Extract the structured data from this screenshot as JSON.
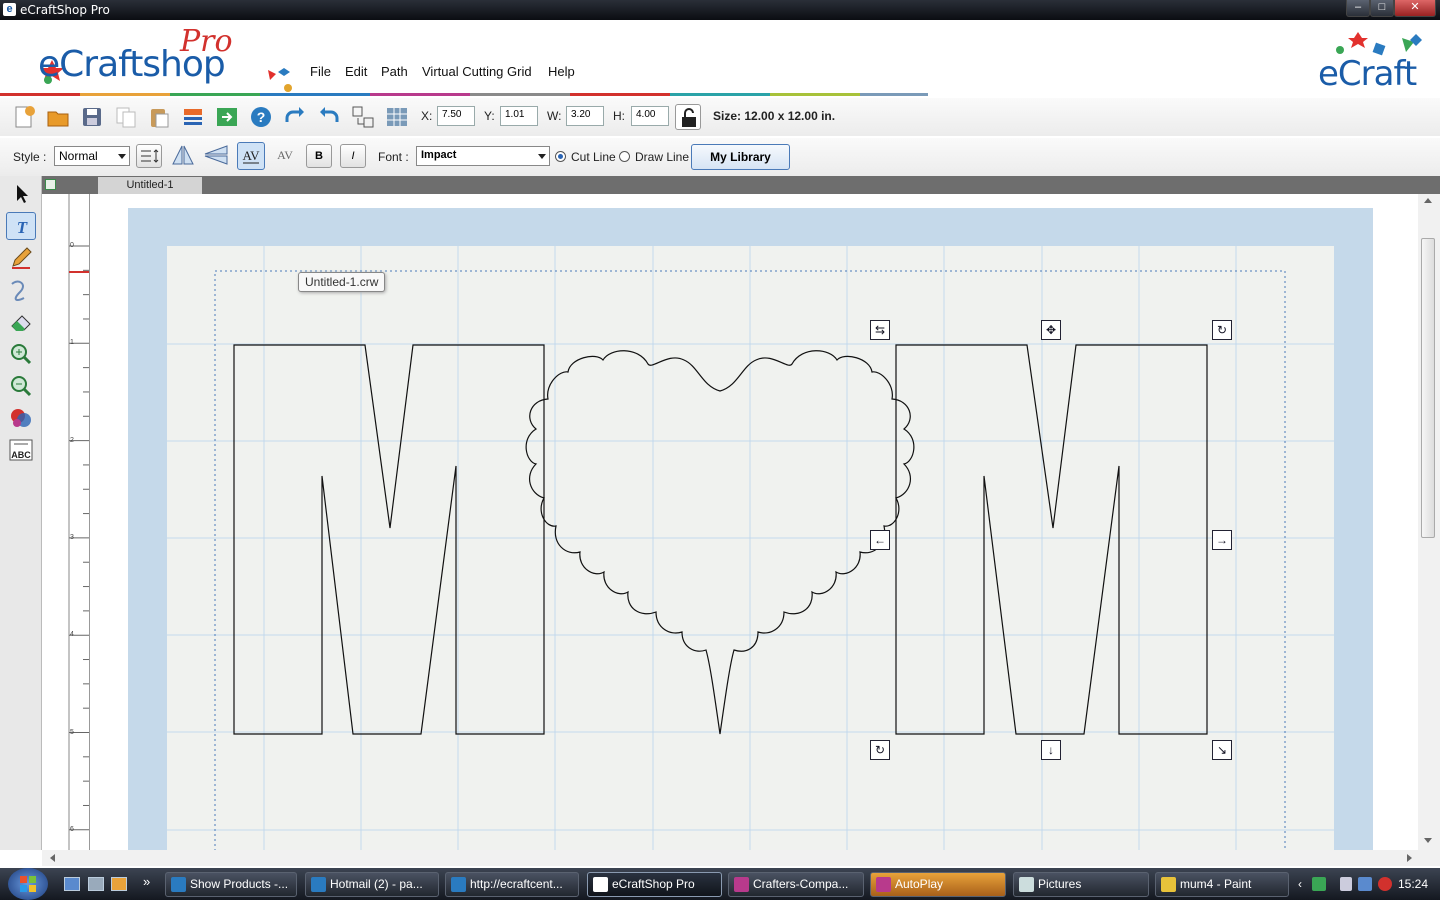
{
  "window": {
    "title": "eCraftShop Pro",
    "app_icon": "e"
  },
  "window_controls": [
    "–",
    "□",
    "✕"
  ],
  "logo": {
    "pro_word": "Pro",
    "brand": "eCraftshop",
    "right_brand": "eCraft"
  },
  "menu": [
    "File",
    "Edit",
    "Path",
    "Virtual Cutting Grid",
    "Help"
  ],
  "toolbar1": {
    "icons": [
      "new-file-icon",
      "open-folder-icon",
      "save-icon",
      "copy-icon",
      "paste-icon",
      "import-icon",
      "export-icon",
      "help-icon",
      "redo-icon",
      "undo-icon",
      "align-icon",
      "grid-icon"
    ],
    "x_label": "X:",
    "x_value": "7.50",
    "y_label": "Y:",
    "y_value": "1.01",
    "w_label": "W:",
    "w_value": "3.20",
    "h_label": "H:",
    "h_value": "4.00",
    "size_text": "Size: 12.00 x 12.00 in."
  },
  "toolbar2": {
    "style_label": "Style :",
    "style_value": "Normal",
    "bold_label": "B",
    "italic_label": "I",
    "font_label": "Font :",
    "font_value": "Impact",
    "cut_line_label": "Cut Line",
    "draw_line_label": "Draw Line",
    "cut_line_selected": true,
    "my_library_label": "My Library"
  },
  "left_tools": [
    "select-arrow-icon",
    "text-tool-icon",
    "pencil-icon",
    "curve-pen-icon",
    "eraser-icon",
    "zoom-in-icon",
    "zoom-out-icon",
    "color-shapes-icon",
    "abc-text-icon"
  ],
  "document_tab": "Untitled-1",
  "tooltip": "Untitled-1.crw",
  "ruler_labels": [
    "0",
    "1",
    "2",
    "3",
    "4",
    "5",
    "6"
  ],
  "handles": {
    "flip": "⇆",
    "move": "✥",
    "rotate": "↻",
    "left": "←",
    "right": "→",
    "down": "↓",
    "resize": "↘"
  },
  "taskbar": {
    "items": [
      "Show Products -...",
      "Hotmail (2) - pa...",
      "http://ecraftcent...",
      "eCraftShop Pro",
      "Crafters-Compa...",
      "AutoPlay",
      "Pictures",
      "mum4 - Paint"
    ],
    "clock": "15:24"
  },
  "colors": {
    "accent": "#2a64b4",
    "mat": "#c5d9ea",
    "page": "#f0f2ef",
    "grid": "#c3d9ec"
  }
}
